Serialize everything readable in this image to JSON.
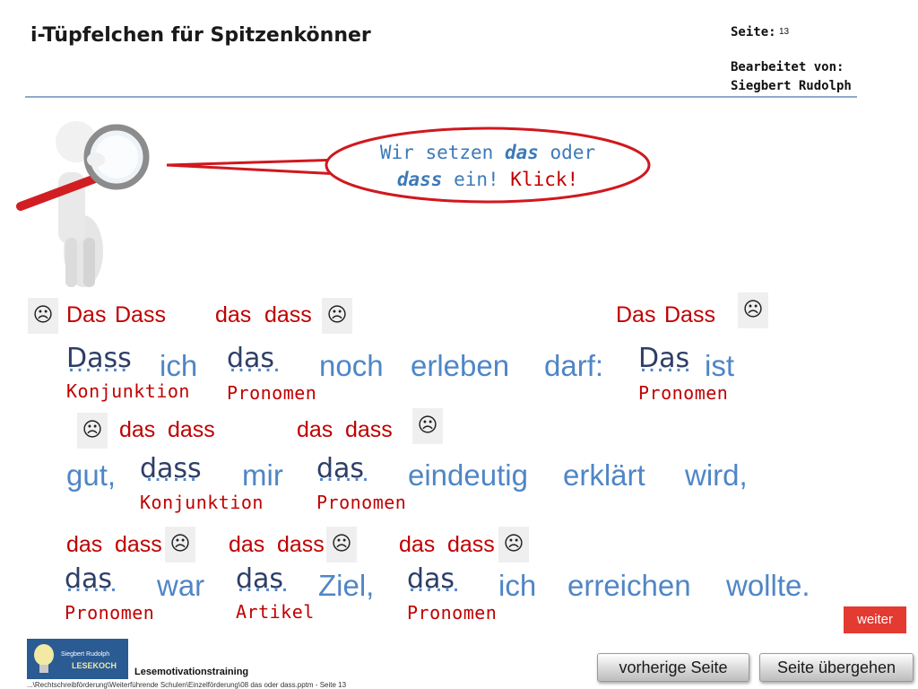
{
  "header": {
    "title": "i-Tüpfelchen für Spitzenkönner",
    "page_label": "Seite:",
    "page_number": "13",
    "edited_label": "Bearbeitet von:",
    "editor": "Siegbert Rudolph"
  },
  "bubble": {
    "line1_prefix": "Wir setzen ",
    "line1_em": "das",
    "line1_suffix": " oder",
    "line2_em": "dass",
    "line2_mid": " ein! ",
    "line2_klick": "Klick!"
  },
  "row1": {
    "options": [
      {
        "das": "Das",
        "dass": "Dass"
      },
      {
        "das": "das",
        "dass": "dass"
      },
      {
        "das": "Das",
        "dass": "Dass"
      }
    ],
    "words": [
      "ich",
      "noch",
      "erleben",
      "darf:",
      "ist"
    ],
    "blanks": [
      "…….",
      "……",
      "……"
    ],
    "answers": [
      "Dass",
      "das",
      "Das"
    ],
    "labels": [
      "Konjunktion",
      "Pronomen",
      "Pronomen"
    ]
  },
  "row2": {
    "options": [
      {
        "das": "das",
        "dass": "dass"
      },
      {
        "das": "das",
        "dass": "dass"
      }
    ],
    "words": [
      "gut,",
      "mir",
      "eindeutig",
      "erklärt",
      "wird,"
    ],
    "blanks": [
      "……",
      "……"
    ],
    "answers": [
      "dass",
      "das"
    ],
    "labels": [
      "Konjunktion",
      "Pronomen"
    ]
  },
  "row3": {
    "options": [
      {
        "das": "das",
        "dass": "dass"
      },
      {
        "das": "das",
        "dass": "dass"
      },
      {
        "das": "das",
        "dass": "dass"
      }
    ],
    "words": [
      "war",
      "Ziel,",
      "ich",
      "erreichen",
      "wollte."
    ],
    "blanks": [
      "……",
      "……",
      "……"
    ],
    "answers": [
      "das",
      "das",
      "das"
    ],
    "labels": [
      "Pronomen",
      "Artikel",
      "Pronomen"
    ]
  },
  "frown_symbol": "☹",
  "buttons": {
    "weiter": "weiter",
    "previous": "vorherige Seite",
    "skip": "Seite übergehen"
  },
  "footer": {
    "logo_line1": "Siegbert Rudolph",
    "logo_line2": "LESEKOCH",
    "program": "Lesemotivationstraining",
    "path": "...\\Rechtschreibförderung\\Weiterführende Schulen\\Einzelförderung\\08 das oder dass.pptm - Seite 13"
  },
  "colors": {
    "word_blue": "#4f86c6",
    "answer_navy": "#2d3e66",
    "label_red": "#c00000",
    "bubble_border": "#d0181e",
    "weiter_bg": "#e33a32"
  }
}
